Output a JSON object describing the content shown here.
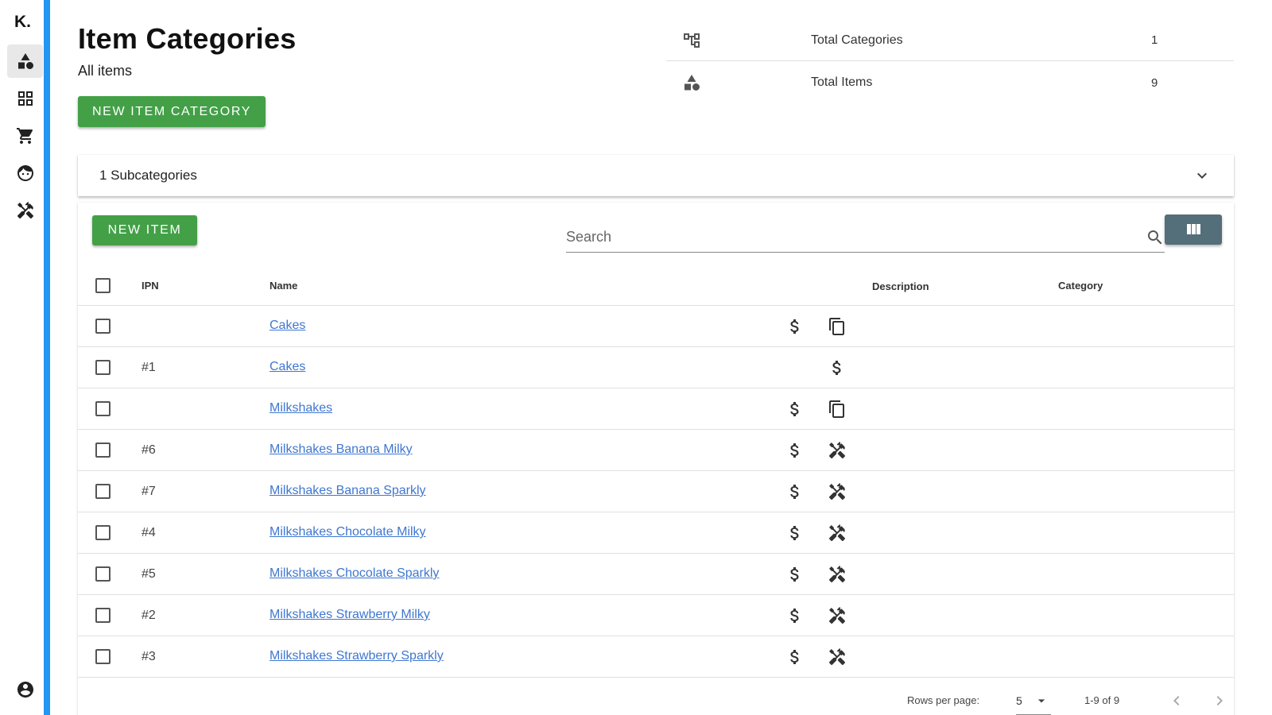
{
  "sidebar": {
    "logo": "K.",
    "items": [
      {
        "icon": "shapes-icon",
        "active": true
      },
      {
        "icon": "grid-icon",
        "active": false
      },
      {
        "icon": "cart-icon",
        "active": false
      },
      {
        "icon": "face-icon",
        "active": false
      },
      {
        "icon": "tools-icon",
        "active": false
      }
    ],
    "account_icon": "account-circle-icon"
  },
  "header": {
    "title": "Item Categories",
    "subtitle": "All items",
    "new_category_label": "NEW ITEM CATEGORY"
  },
  "stats": [
    {
      "icon": "hierarchy-icon",
      "label": "Total Categories",
      "value": "1"
    },
    {
      "icon": "shapes-icon",
      "label": "Total Items",
      "value": "9"
    }
  ],
  "subcategories": {
    "label": "1 Subcategories"
  },
  "toolbar": {
    "new_item_label": "NEW ITEM",
    "search_placeholder": "Search",
    "search_value": ""
  },
  "table": {
    "columns": {
      "ipn": "IPN",
      "name": "Name",
      "description": "Description",
      "category": "Category"
    },
    "rows": [
      {
        "ipn": "",
        "name": "Cakes",
        "icons": [
          "dollar-icon",
          "copy-icon"
        ]
      },
      {
        "ipn": "#1",
        "name": "Cakes",
        "icons": [
          "",
          "dollar-icon"
        ]
      },
      {
        "ipn": "",
        "name": "Milkshakes",
        "icons": [
          "dollar-icon",
          "copy-icon"
        ]
      },
      {
        "ipn": "#6",
        "name": "Milkshakes Banana Milky",
        "icons": [
          "dollar-icon",
          "tools-icon"
        ]
      },
      {
        "ipn": "#7",
        "name": "Milkshakes Banana Sparkly",
        "icons": [
          "dollar-icon",
          "tools-icon"
        ]
      },
      {
        "ipn": "#4",
        "name": "Milkshakes Chocolate Milky",
        "icons": [
          "dollar-icon",
          "tools-icon"
        ]
      },
      {
        "ipn": "#5",
        "name": "Milkshakes Chocolate Sparkly",
        "icons": [
          "dollar-icon",
          "tools-icon"
        ]
      },
      {
        "ipn": "#2",
        "name": "Milkshakes Strawberry Milky",
        "icons": [
          "dollar-icon",
          "tools-icon"
        ]
      },
      {
        "ipn": "#3",
        "name": "Milkshakes Strawberry Sparkly",
        "icons": [
          "dollar-icon",
          "tools-icon"
        ]
      }
    ]
  },
  "pagination": {
    "rows_per_page_label": "Rows per page:",
    "rows_per_page_value": "5",
    "range": "1-9 of 9"
  },
  "colors": {
    "accent_blue": "#2196f3",
    "button_green": "#43a047",
    "column_button": "#546e7a",
    "link": "#3f77d0"
  }
}
